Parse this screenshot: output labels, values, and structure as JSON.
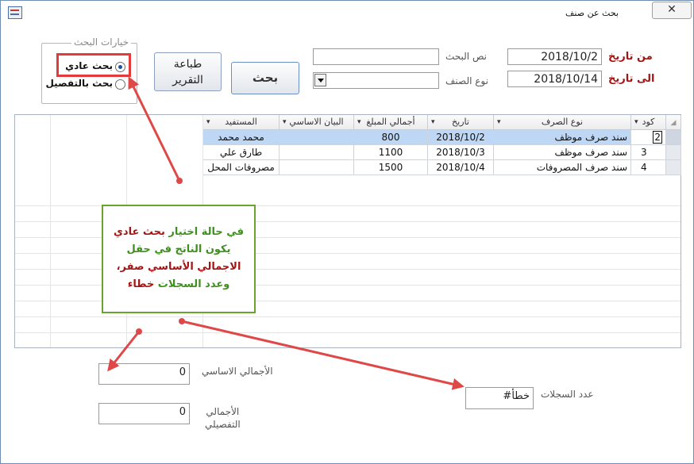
{
  "window": {
    "title": "بحث عن صنف",
    "close_glyph": "✕"
  },
  "search_options": {
    "legend": "خيارات البحث",
    "options": [
      {
        "label": "بحث عادي",
        "selected": true
      },
      {
        "label": "بحث بالتفصيل",
        "selected": false
      }
    ]
  },
  "buttons": {
    "print_line1": "طباعة",
    "print_line2": "التقرير",
    "search": "بحث"
  },
  "fields": {
    "search_text_label": "نص البحث",
    "search_text_value": "",
    "item_type_label": "نوع الصنف",
    "item_type_value": "",
    "from_date_label": "من تاريخ",
    "from_date_value": "2018/10/2",
    "to_date_label": "الى تاريخ",
    "to_date_value": "2018/10/14"
  },
  "table": {
    "columns": [
      "كود",
      "نوع الصرف",
      "تاريخ",
      "أجمالي المبلغ",
      "البيان الاساسي",
      "المستفيد"
    ],
    "rows": [
      {
        "code": "2",
        "type": "سند صرف موظف",
        "date": "2018/10/2",
        "amount": "800",
        "statement": "",
        "beneficiary": "محمد محمد"
      },
      {
        "code": "3",
        "type": "سند صرف موظف",
        "date": "2018/10/3",
        "amount": "1100",
        "statement": "",
        "beneficiary": "طارق علي"
      },
      {
        "code": "4",
        "type": "سند صرف المصروفات",
        "date": "2018/10/4",
        "amount": "1500",
        "statement": "",
        "beneficiary": "مصروفات المحل"
      }
    ]
  },
  "annotation": {
    "line1a": "في حالة اختيار ",
    "line1b": "بحث عادي",
    "line2": "يكون الناتج في حقل",
    "line3": "الاجمالي الأساسي صفر،",
    "line4a": "وعدد السجلات ",
    "line4b": "خطاء"
  },
  "footer": {
    "basic_total_label": "الأجمالي الاساسي",
    "basic_total_value": "0",
    "detail_total_label_1": "الأجمالي",
    "detail_total_label_2": "التفصيلي",
    "detail_total_value": "0",
    "record_count_label": "عدد السجلات",
    "record_count_value": "#خطأ"
  },
  "colors": {
    "highlight_red": "#e23b3b",
    "annotation_green": "#6aa32e",
    "arrow": "#e04848",
    "selection": "#bdd7f5"
  }
}
